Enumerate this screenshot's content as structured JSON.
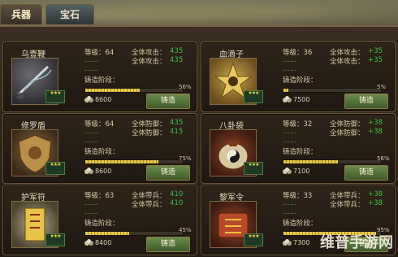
{
  "tabs": [
    {
      "label": "兵器",
      "active": true
    },
    {
      "label": "宝石",
      "active": false
    }
  ],
  "cards": [
    {
      "name": "乌壹鞭",
      "level": "等级：64",
      "stat_a_label": "全体攻击：",
      "stat_a_val": "435",
      "stat_b_label": "全体攻击：",
      "stat_b_val": "435",
      "green_a": "……",
      "green_b": "……",
      "stage_label": "铸造阶段：",
      "percent": "56%",
      "progress": 56,
      "cost": "8600",
      "button": "铸造"
    },
    {
      "name": "血滴子",
      "level": "等级：36",
      "stat_a_label": "全体攻击：",
      "stat_a_val": "+35",
      "stat_b_label": "全体攻击：",
      "stat_b_val": "+35",
      "green_a": "……",
      "green_b": "……",
      "stage_label": "铸造阶段：",
      "percent": "5%",
      "progress": 5,
      "cost": "7500",
      "button": "铸造"
    },
    {
      "name": "修罗盾",
      "level": "等级：64",
      "stat_a_label": "全体防御：",
      "stat_a_val": "435",
      "stat_b_label": "全体防御：",
      "stat_b_val": "415",
      "green_a": "……",
      "green_b": "……",
      "stage_label": "铸造阶段：",
      "percent": "75%",
      "progress": 75,
      "cost": "8600",
      "button": "铸造"
    },
    {
      "name": "八卦袋",
      "level": "等级：32",
      "stat_a_label": "全体防御：",
      "stat_a_val": "+38",
      "stat_b_label": "全体防御：",
      "stat_b_val": "+38",
      "green_a": "……",
      "green_b": "……",
      "stage_label": "铸造阶段：",
      "percent": "56%",
      "progress": 56,
      "cost": "7100",
      "button": "铸造"
    },
    {
      "name": "护军符",
      "level": "等级：63",
      "stat_a_label": "全体带兵：",
      "stat_a_val": "410",
      "stat_b_label": "全体带兵：",
      "stat_b_val": "410",
      "green_a": "……",
      "green_b": "……",
      "stage_label": "铸造阶段：",
      "percent": "45%",
      "progress": 45,
      "cost": "8400",
      "button": "铸造"
    },
    {
      "name": "黎军令",
      "level": "等级：33",
      "stat_a_label": "全体带兵：",
      "stat_a_val": "+38",
      "stat_b_label": "全体带兵：",
      "stat_b_val": "+38",
      "green_a": "……",
      "green_b": "……",
      "stage_label": "铸造阶段：",
      "percent": "95%",
      "progress": 95,
      "cost": "7300",
      "button": "铸造"
    }
  ],
  "watermark": "维普手游网",
  "colors": {
    "accent_green": "#3fbf4a",
    "button_green": "#5b7a3a",
    "progress_gold": "#e8c84a"
  }
}
